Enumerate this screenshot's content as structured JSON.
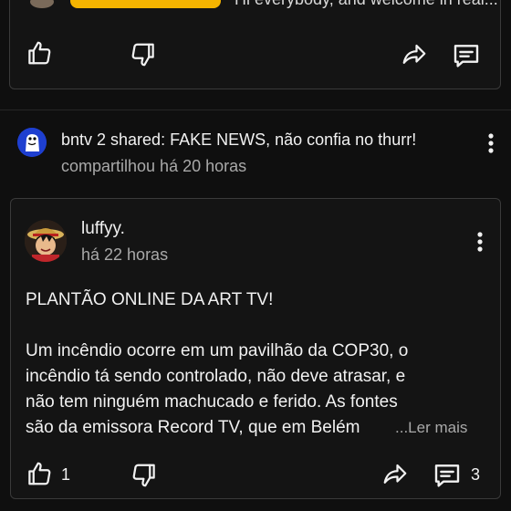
{
  "top_card": {
    "partial_text": "Hi everybody, and welcome in real...",
    "actions": {
      "like_icon": "thumbs-up-icon",
      "dislike_icon": "thumbs-down-icon",
      "share_icon": "share-icon",
      "comment_icon": "comment-icon"
    }
  },
  "shared_post": {
    "author_line": "bntv 2 shared: FAKE NEWS, não confia no thurr!",
    "time": "compartilhou há 20 horas",
    "menu_icon": "more-vertical-icon"
  },
  "original_post": {
    "author": "luffyy.",
    "time": "há 22 horas",
    "menu_icon": "more-vertical-icon",
    "headline": "PLANTÃO ONLINE DA ART TV!",
    "body_lines": [
      "Um incêndio ocorre em um pavilhão da COP30, o",
      "incêndio tá sendo controlado, não deve atrasar, e",
      "não tem ninguém machucado e ferido. As fontes",
      "são da emissora Record TV, que em Belém"
    ],
    "read_more": "...Ler mais",
    "like_count": "1",
    "comment_count": "3"
  },
  "colors": {
    "background": "#0f0f0f",
    "card_border": "#3a3a3a",
    "badge": "#f5b400",
    "muted_text": "#a9a9a9"
  }
}
